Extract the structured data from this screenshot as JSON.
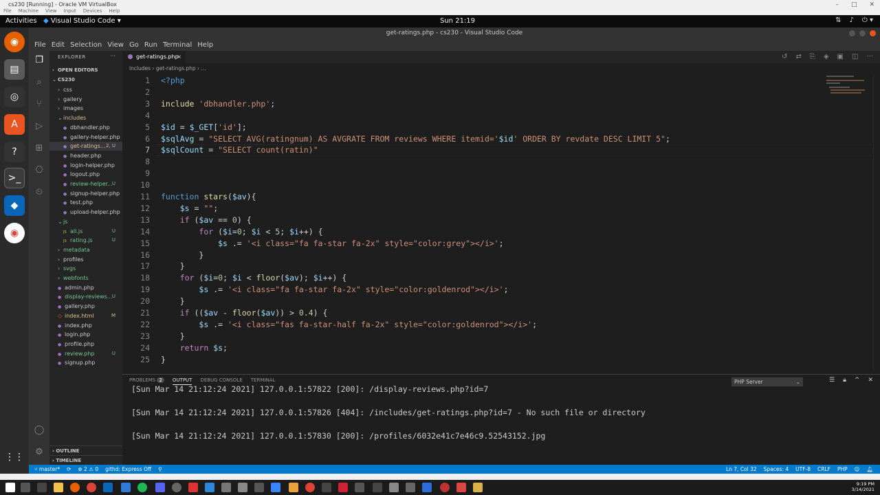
{
  "vbox": {
    "title": "cs230 [Running] - Oracle VM VirtualBox",
    "menus": [
      "File",
      "Machine",
      "View",
      "Input",
      "Devices",
      "Help"
    ]
  },
  "gnome": {
    "activities": "Activities",
    "app_name": "Visual Studio Code",
    "clock": "Sun 21:19"
  },
  "window": {
    "title": "get-ratings.php - cs230 - Visual Studio Code"
  },
  "menubar": [
    "File",
    "Edit",
    "Selection",
    "View",
    "Go",
    "Run",
    "Terminal",
    "Help"
  ],
  "sidebar": {
    "header": "EXPLORER",
    "open_editors": "OPEN EDITORS",
    "root": "CS230",
    "items": [
      {
        "label": "css",
        "kind": "folder",
        "badge": "",
        "color": "#cccccc",
        "indent": 1
      },
      {
        "label": "gallery",
        "kind": "folder",
        "badge": "",
        "color": "#cccccc",
        "indent": 1
      },
      {
        "label": "images",
        "kind": "folder",
        "badge": "",
        "color": "#cccccc",
        "indent": 1
      },
      {
        "label": "includes",
        "kind": "folder-open",
        "badge": "",
        "color": "#e2c08d",
        "indent": 1
      },
      {
        "label": "dbhandler.php",
        "kind": "file",
        "badge": "",
        "color": "#cccccc",
        "indent": 2
      },
      {
        "label": "gallery-helper.php",
        "kind": "file",
        "badge": "",
        "color": "#cccccc",
        "indent": 2
      },
      {
        "label": "get-ratings...",
        "kind": "file",
        "badge": "2, U",
        "color": "#e2c08d",
        "indent": 2
      },
      {
        "label": "header.php",
        "kind": "file",
        "badge": "",
        "color": "#cccccc",
        "indent": 2
      },
      {
        "label": "login-helper.php",
        "kind": "file",
        "badge": "",
        "color": "#cccccc",
        "indent": 2
      },
      {
        "label": "logout.php",
        "kind": "file",
        "badge": "",
        "color": "#cccccc",
        "indent": 2
      },
      {
        "label": "review-helper...",
        "kind": "file",
        "badge": "U",
        "color": "#73c991",
        "indent": 2
      },
      {
        "label": "signup-helper.php",
        "kind": "file",
        "badge": "",
        "color": "#cccccc",
        "indent": 2
      },
      {
        "label": "test.php",
        "kind": "file",
        "badge": "",
        "color": "#cccccc",
        "indent": 2
      },
      {
        "label": "upload-helper.php",
        "kind": "file",
        "badge": "",
        "color": "#cccccc",
        "indent": 2
      },
      {
        "label": "js",
        "kind": "folder-open",
        "badge": "",
        "color": "#73c991",
        "indent": 1
      },
      {
        "label": "all.js",
        "kind": "jsfile",
        "badge": "U",
        "color": "#73c991",
        "indent": 2
      },
      {
        "label": "rating.js",
        "kind": "jsfile",
        "badge": "U",
        "color": "#73c991",
        "indent": 2
      },
      {
        "label": "metadata",
        "kind": "folder",
        "badge": "",
        "color": "#73c991",
        "indent": 1
      },
      {
        "label": "profiles",
        "kind": "folder",
        "badge": "",
        "color": "#cccccc",
        "indent": 1
      },
      {
        "label": "svgs",
        "kind": "folder",
        "badge": "",
        "color": "#73c991",
        "indent": 1
      },
      {
        "label": "webfonts",
        "kind": "folder",
        "badge": "",
        "color": "#73c991",
        "indent": 1
      },
      {
        "label": "admin.php",
        "kind": "file",
        "badge": "",
        "color": "#cccccc",
        "indent": 1
      },
      {
        "label": "display-reviews...",
        "kind": "file",
        "badge": "U",
        "color": "#73c991",
        "indent": 1
      },
      {
        "label": "gallery.php",
        "kind": "file",
        "badge": "",
        "color": "#cccccc",
        "indent": 1
      },
      {
        "label": "index.html",
        "kind": "htmlfile",
        "badge": "M",
        "color": "#e2c08d",
        "indent": 1
      },
      {
        "label": "index.php",
        "kind": "file",
        "badge": "",
        "color": "#cccccc",
        "indent": 1
      },
      {
        "label": "login.php",
        "kind": "file",
        "badge": "",
        "color": "#cccccc",
        "indent": 1
      },
      {
        "label": "profile.php",
        "kind": "file",
        "badge": "",
        "color": "#cccccc",
        "indent": 1
      },
      {
        "label": "review.php",
        "kind": "file",
        "badge": "U",
        "color": "#73c991",
        "indent": 1
      },
      {
        "label": "signup.php",
        "kind": "file",
        "badge": "",
        "color": "#cccccc",
        "indent": 1
      }
    ],
    "outline": "OUTLINE",
    "timeline": "TIMELINE"
  },
  "editor": {
    "tab_label": "get-ratings.php",
    "breadcrumb": "includes  ›  get-ratings.php  ›  ...",
    "current_line": 7,
    "lines": [
      [
        [
          "tag",
          "<?php"
        ]
      ],
      [],
      [
        [
          "fn",
          "include"
        ],
        [
          "txt",
          " "
        ],
        [
          "str",
          "'dbhandler.php'"
        ],
        [
          "txt",
          ";"
        ]
      ],
      [],
      [
        [
          "var",
          "$id"
        ],
        [
          "txt",
          " = "
        ],
        [
          "var",
          "$_GET"
        ],
        [
          "txt",
          "["
        ],
        [
          "str",
          "'id'"
        ],
        [
          "txt",
          "];"
        ]
      ],
      [
        [
          "var",
          "$sqlAvg"
        ],
        [
          "txt",
          " = "
        ],
        [
          "str",
          "\"SELECT AVG(ratingnum) AS AVGRATE FROM reviews WHERE itemid='"
        ],
        [
          "var",
          "$id"
        ],
        [
          "str",
          "' ORDER BY revdate DESC LIMIT 5\""
        ],
        [
          "txt",
          ";"
        ]
      ],
      [
        [
          "var",
          "$sqlCount"
        ],
        [
          "txt",
          " = "
        ],
        [
          "str",
          "\"SELECT count(ratin)\""
        ]
      ],
      [],
      [],
      [],
      [
        [
          "kw",
          "function"
        ],
        [
          "txt",
          " "
        ],
        [
          "fn",
          "stars"
        ],
        [
          "txt",
          "("
        ],
        [
          "var",
          "$av"
        ],
        [
          "txt",
          "){"
        ]
      ],
      [
        [
          "txt",
          "    "
        ],
        [
          "var",
          "$s"
        ],
        [
          "txt",
          " = "
        ],
        [
          "str",
          "\"\""
        ],
        [
          "txt",
          ";"
        ]
      ],
      [
        [
          "txt",
          "    "
        ],
        [
          "ctl",
          "if"
        ],
        [
          "txt",
          " ("
        ],
        [
          "var",
          "$av"
        ],
        [
          "txt",
          " == "
        ],
        [
          "num",
          "0"
        ],
        [
          "txt",
          ") {"
        ]
      ],
      [
        [
          "txt",
          "        "
        ],
        [
          "ctl",
          "for"
        ],
        [
          "txt",
          " ("
        ],
        [
          "var",
          "$i"
        ],
        [
          "txt",
          "="
        ],
        [
          "num",
          "0"
        ],
        [
          "txt",
          "; "
        ],
        [
          "var",
          "$i"
        ],
        [
          "txt",
          " < "
        ],
        [
          "num",
          "5"
        ],
        [
          "txt",
          "; "
        ],
        [
          "var",
          "$i"
        ],
        [
          "txt",
          "++) {"
        ]
      ],
      [
        [
          "txt",
          "            "
        ],
        [
          "var",
          "$s"
        ],
        [
          "txt",
          " .= "
        ],
        [
          "str",
          "'<i class=\"fa fa-star fa-2x\" style=\"color:grey\"></i>'"
        ],
        [
          "txt",
          ";"
        ]
      ],
      [
        [
          "txt",
          "        }"
        ]
      ],
      [
        [
          "txt",
          "    }"
        ]
      ],
      [
        [
          "txt",
          "    "
        ],
        [
          "ctl",
          "for"
        ],
        [
          "txt",
          " ("
        ],
        [
          "var",
          "$i"
        ],
        [
          "txt",
          "="
        ],
        [
          "num",
          "0"
        ],
        [
          "txt",
          "; "
        ],
        [
          "var",
          "$i"
        ],
        [
          "txt",
          " < "
        ],
        [
          "fn",
          "floor"
        ],
        [
          "txt",
          "("
        ],
        [
          "var",
          "$av"
        ],
        [
          "txt",
          "); "
        ],
        [
          "var",
          "$i"
        ],
        [
          "txt",
          "++) {"
        ]
      ],
      [
        [
          "txt",
          "        "
        ],
        [
          "var",
          "$s"
        ],
        [
          "txt",
          " .= "
        ],
        [
          "str",
          "'<i class=\"fa fa-star fa-2x\" style=\"color:goldenrod\"></i>'"
        ],
        [
          "txt",
          ";"
        ]
      ],
      [
        [
          "txt",
          "    }"
        ]
      ],
      [
        [
          "txt",
          "    "
        ],
        [
          "ctl",
          "if"
        ],
        [
          "txt",
          " (("
        ],
        [
          "var",
          "$av"
        ],
        [
          "txt",
          " - "
        ],
        [
          "fn",
          "floor"
        ],
        [
          "txt",
          "("
        ],
        [
          "var",
          "$av"
        ],
        [
          "txt",
          ")) > "
        ],
        [
          "num",
          "0.4"
        ],
        [
          "txt",
          ") {"
        ]
      ],
      [
        [
          "txt",
          "        "
        ],
        [
          "var",
          "$s"
        ],
        [
          "txt",
          " .= "
        ],
        [
          "str",
          "'<i class=\"fas fa-star-half fa-2x\" style=\"color:goldenrod\"></i>'"
        ],
        [
          "txt",
          ";"
        ]
      ],
      [
        [
          "txt",
          "    }"
        ]
      ],
      [
        [
          "txt",
          "    "
        ],
        [
          "ctl",
          "return"
        ],
        [
          "txt",
          " "
        ],
        [
          "var",
          "$s"
        ],
        [
          "txt",
          ";"
        ]
      ],
      [
        [
          "txt",
          "}"
        ]
      ]
    ]
  },
  "panel": {
    "tabs": [
      "PROBLEMS",
      "OUTPUT",
      "DEBUG CONSOLE",
      "TERMINAL"
    ],
    "problems_count": "2",
    "active_tab": "OUTPUT",
    "channel": "PHP Server",
    "output": [
      "[Sun Mar 14 21:12:24 2021] 127.0.0.1:57822 [200]: /display-reviews.php?id=7",
      "[Sun Mar 14 21:12:24 2021] 127.0.0.1:57826 [404]: /includes/get-ratings.php?id=7 - No such file or directory",
      "[Sun Mar 14 21:12:24 2021] 127.0.0.1:57830 [200]: /profiles/6032e41c7e46c9.52543152.jpg"
    ]
  },
  "statusbar": {
    "branch": "master*",
    "problems": "⊗ 2 ⚠ 0",
    "githd": "githd: Express Off",
    "position": "Ln 7, Col 32",
    "spaces": "Spaces: 4",
    "encoding": "UTF-8",
    "eol": "CRLF",
    "language": "PHP"
  },
  "taskbar": {
    "time": "9:19 PM",
    "date": "3/14/2021"
  },
  "colors": {
    "accent": "#007acc",
    "editor_bg": "#1e1e1e",
    "sidebar_bg": "#252526"
  }
}
